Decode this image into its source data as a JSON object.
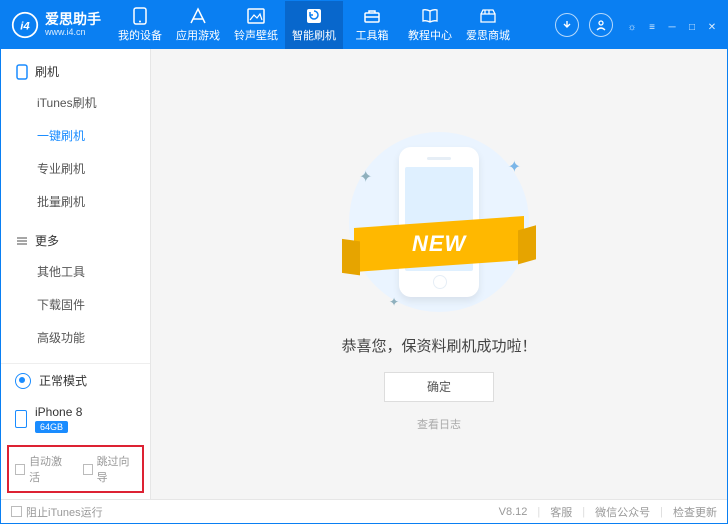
{
  "brand": {
    "name": "爱思助手",
    "url": "www.i4.cn"
  },
  "nav": [
    {
      "label": "我的设备"
    },
    {
      "label": "应用游戏"
    },
    {
      "label": "铃声壁纸"
    },
    {
      "label": "智能刷机"
    },
    {
      "label": "工具箱"
    },
    {
      "label": "教程中心"
    },
    {
      "label": "爱思商城"
    }
  ],
  "sidebar": {
    "group1": {
      "title": "刷机",
      "items": [
        "iTunes刷机",
        "一键刷机",
        "专业刷机",
        "批量刷机"
      ]
    },
    "group2": {
      "title": "更多",
      "items": [
        "其他工具",
        "下载固件",
        "高级功能"
      ]
    },
    "mode": "正常模式",
    "device": {
      "name": "iPhone 8",
      "storage": "64GB"
    },
    "checks": [
      "自动激活",
      "跳过向导"
    ]
  },
  "main": {
    "ribbon": "NEW",
    "message": "恭喜您，保资料刷机成功啦！",
    "ok": "确定",
    "view_log": "查看日志"
  },
  "status": {
    "prevent": "阻止iTunes运行",
    "version": "V8.12",
    "support": "客服",
    "wechat": "微信公众号",
    "update": "检查更新"
  }
}
